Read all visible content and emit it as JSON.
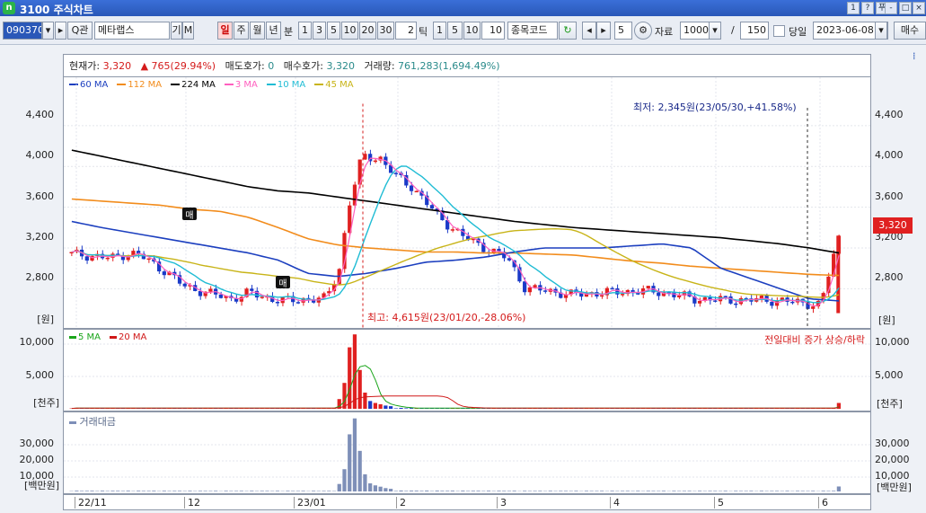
{
  "window": {
    "id": "3100",
    "title": "주식차트",
    "btns": [
      "1",
      "?",
      "푸",
      "-",
      "□",
      "×"
    ]
  },
  "toolbar": {
    "code": "090370",
    "name": "메타랩스",
    "name_btn_a": "기",
    "name_btn_b": "M",
    "search_btn": "Q관",
    "periods": [
      "일",
      "주",
      "월",
      "년",
      "분"
    ],
    "minute_vals": [
      "1",
      "3",
      "5",
      "10",
      "20",
      "30"
    ],
    "minute_input": "2",
    "tick_label": "틱",
    "tick_vals": [
      "1",
      "5",
      "10"
    ],
    "tick_input": "10",
    "code_combo": "종목코드",
    "step": "5",
    "data_label": "자료",
    "data_count": "1000",
    "slash": "/",
    "view_count": "150",
    "day_label": "당일",
    "date": "2023-06-08",
    "last_btn": "매수"
  },
  "info": {
    "price_label": "현재가:",
    "price": "3,320",
    "change_arrow": "▲",
    "change": "765(29.94%)",
    "ask_label": "매도호가:",
    "ask": "0",
    "bid_label": "매수호가:",
    "bid": "3,320",
    "vol_label": "거래량:",
    "vol": "761,283(1,694.49%)"
  },
  "legend_main": [
    {
      "name": "60 MA",
      "color": "#1c3fbf"
    },
    {
      "name": "112 MA",
      "color": "#f28c1c"
    },
    {
      "name": "224 MA",
      "color": "#000000"
    },
    {
      "name": "3 MA",
      "color": "#ff5fbf"
    },
    {
      "name": "10 MA",
      "color": "#1fbcd4"
    },
    {
      "name": "45 MA",
      "color": "#c8b418"
    }
  ],
  "legend_vol": [
    {
      "name": "5 MA",
      "color": "#1aa51a"
    },
    {
      "name": "20 MA",
      "color": "#d01818"
    }
  ],
  "legend_amt": "거래대금",
  "annotations": {
    "low": "최저: 2,345원(23/05/30,+41.58%)",
    "high": "최고: 4,615원(23/01/20,-28.06%)",
    "vol_note": "전일대비 증가 상승/하락",
    "buy_mark": "매",
    "sell_mark": "매",
    "last_price": "3,320"
  },
  "axes": {
    "price_ticks": [
      "4,400",
      "4,000",
      "3,600",
      "3,200",
      "2,800"
    ],
    "price_unit": "[원]",
    "vol_ticks": [
      "10,000",
      "5,000"
    ],
    "vol_unit": "[천주]",
    "amt_ticks": [
      "30,000",
      "20,000",
      "10,000"
    ],
    "amt_unit": "[백만원]",
    "x_ticks": [
      "22/11",
      "12",
      "23/01",
      "2",
      "3",
      "4",
      "5",
      "6"
    ]
  },
  "chart_data": {
    "type": "line",
    "series": [
      {
        "name": "224 MA",
        "values": [
          4160,
          4100,
          4040,
          3980,
          3920,
          3860,
          3800,
          3760,
          3740,
          3700,
          3660,
          3620,
          3580,
          3540,
          3500,
          3460,
          3430,
          3400,
          3380,
          3360,
          3340,
          3320,
          3300,
          3270,
          3240,
          3200,
          3150
        ]
      },
      {
        "name": "112 MA",
        "values": [
          3680,
          3660,
          3640,
          3620,
          3580,
          3560,
          3500,
          3400,
          3290,
          3230,
          3200,
          3180,
          3160,
          3160,
          3150,
          3150,
          3140,
          3130,
          3100,
          3070,
          3050,
          3020,
          3000,
          2980,
          2960,
          2940,
          2930
        ]
      },
      {
        "name": "60 MA",
        "values": [
          3460,
          3400,
          3350,
          3300,
          3250,
          3200,
          3150,
          3080,
          2950,
          2920,
          2950,
          3000,
          3060,
          3080,
          3110,
          3160,
          3200,
          3200,
          3200,
          3220,
          3240,
          3200,
          3000,
          2900,
          2800,
          2700,
          2680
        ]
      }
    ]
  }
}
